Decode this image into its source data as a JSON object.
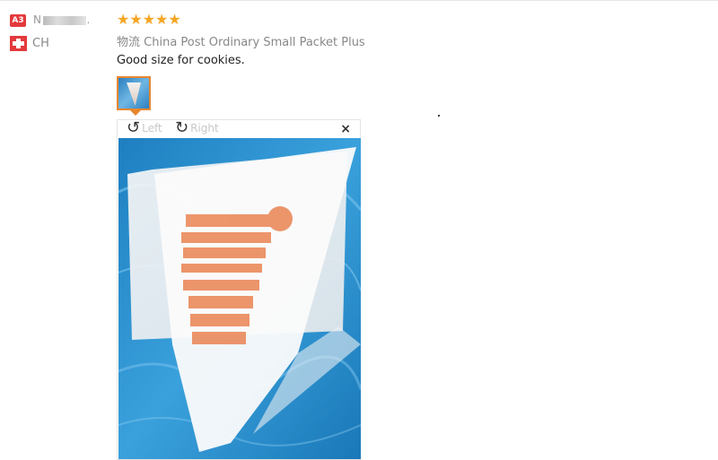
{
  "reviewer": {
    "level_badge": "A3",
    "name_visible": "N",
    "name_suffix": ".",
    "country": "CH"
  },
  "review": {
    "stars": "★★★★★",
    "rating": 5,
    "shipping_prefix": "物流",
    "shipping_method": "China Post Ordinary Small Packet Plus",
    "comment": "Good size for cookies."
  },
  "viewer": {
    "rotate_left_label": "Left",
    "rotate_right_label": "Right",
    "close_glyph": "×"
  },
  "colors": {
    "accent": "#e8862d",
    "star": "#f5a623",
    "badge": "#e4393c",
    "water_blue": "#1f8fd1"
  }
}
